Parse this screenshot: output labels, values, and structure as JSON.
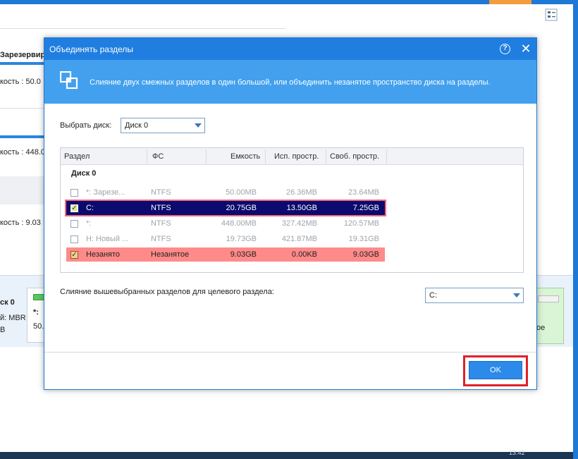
{
  "background": {
    "partition_header": "Зарезервир",
    "capacity_1": "кость : 50.0",
    "capacity_2": "кость : 448.0",
    "capacity_3": "кость : 9.03",
    "disk_label": "ск 0",
    "disk_type": "й: MBR",
    "disk_size": "В",
    "card_name": "*:",
    "card_size": "50.",
    "right_card_text": "ое",
    "clock": "13:42"
  },
  "dialog": {
    "title": "Объединять разделы",
    "help_glyph": "?",
    "close_glyph": "✕",
    "banner_text": "Слияние двух смежных разделов в один большой, или объединить незанятое пространство диска на разделы.",
    "select_disk_label": "Выбрать диск:",
    "select_disk_value": "Диск 0",
    "table": {
      "headers": {
        "partition": "Раздел",
        "fs": "ФС",
        "capacity": "Емкость",
        "used": "Исп. простр.",
        "free": "Своб. простр."
      },
      "group": "Диск 0",
      "rows": [
        {
          "name": "*: Зарезе...",
          "fs": "NTFS",
          "capacity": "50.00MB",
          "used": "26.36MB",
          "free": "23.64MB",
          "checked": "",
          "state": "disabled"
        },
        {
          "name": "C:",
          "fs": "NTFS",
          "capacity": "20.75GB",
          "used": "13.50GB",
          "free": "7.25GB",
          "checked": "✓",
          "state": "selected"
        },
        {
          "name": "*:",
          "fs": "NTFS",
          "capacity": "448.00MB",
          "used": "327.42MB",
          "free": "120.57MB",
          "checked": "",
          "state": "disabled"
        },
        {
          "name": "H: Новый ...",
          "fs": "NTFS",
          "capacity": "19.73GB",
          "used": "421.87MB",
          "free": "19.31GB",
          "checked": "",
          "state": "disabled"
        },
        {
          "name": "Незанято",
          "fs": "Незанятое",
          "capacity": "9.03GB",
          "used": "0.00KB",
          "free": "9.03GB",
          "checked": "✓",
          "state": "unalloc"
        }
      ]
    },
    "target_label": "Слияние вышевыбранных разделов для целевого раздела:",
    "target_value": "C:",
    "ok_label": "OK"
  },
  "colors": {
    "title_bar": "#1f7ee0",
    "banner": "#42a0ee",
    "selected_row": "#0b0a6e",
    "unallocated_row": "#ff8a8a",
    "highlight_outline": "#e0202a"
  }
}
